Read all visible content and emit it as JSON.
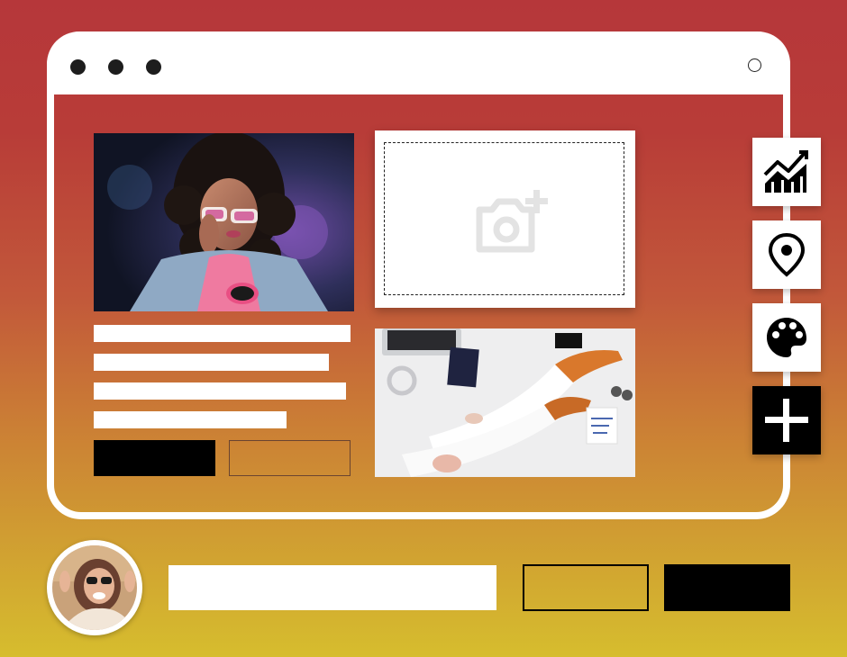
{
  "window": {
    "title_dots": [
      "dot-1",
      "dot-2",
      "dot-3"
    ]
  },
  "profile_card": {
    "text_lines": [
      "",
      "",
      "",
      ""
    ],
    "primary_label": "",
    "secondary_label": ""
  },
  "uploader": {
    "icon": "camera-plus-icon"
  },
  "toolbar": {
    "items": [
      {
        "icon": "chart-icon"
      },
      {
        "icon": "map-pin-icon"
      },
      {
        "icon": "palette-icon"
      },
      {
        "icon": "plus-icon"
      }
    ]
  },
  "bottom_bar": {
    "input_value": "",
    "outline_button_label": "",
    "dark_button_label": ""
  },
  "colors": {
    "gradient_top": "#b6373a",
    "gradient_bottom": "#d6bd2e",
    "dark": "#000000",
    "light": "#ffffff"
  }
}
